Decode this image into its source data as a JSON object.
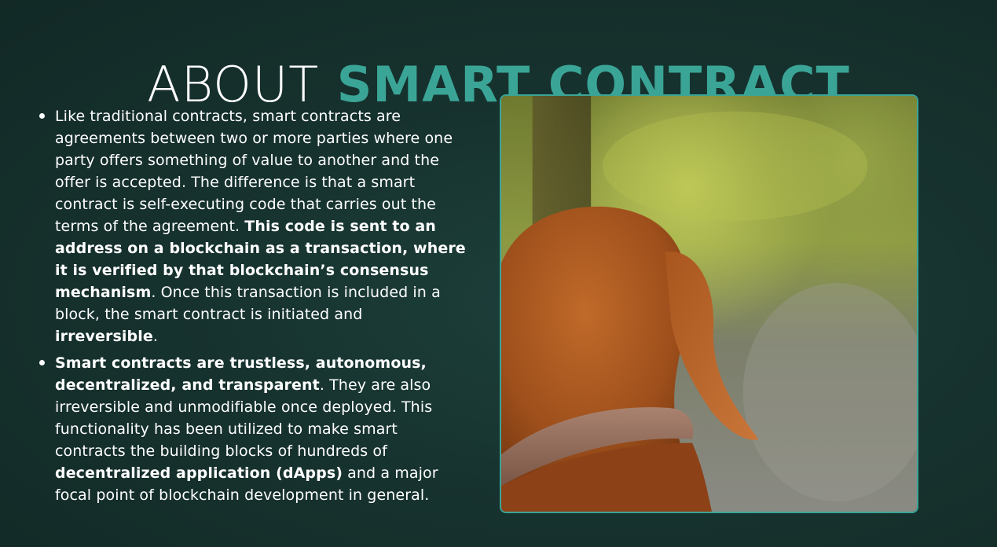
{
  "header": {
    "title_light": "ABOUT",
    "title_accent": "SMART CONTRACT"
  },
  "bullets": [
    {
      "p1": "Like traditional contracts, smart contracts are agreements between two or more parties where one party offers something of value to another and the offer is accepted. The difference is that a smart contract is self-executing code that carries out the terms of the agreement. ",
      "b1": "This code is sent to an address on a blockchain as a transaction, where it is verified by that blockchain’s consensus mechanism",
      "p2": ". Once this transaction is included in a block, the smart contract is initiated and ",
      "b2": "irreversible",
      "p3": "."
    },
    {
      "b1": "Smart contracts are trustless, autonomous, decentralized, and transparent",
      "p1": ". They are also irreversible and unmodifiable once deployed. This functionality has been utilized to make smart contracts the building blocks of hundreds of ",
      "b2": "decentralized application (dApps)",
      "p2": " and a major focal point of blockchain development in general."
    }
  ],
  "image": {
    "subject": "brown-dog-photo"
  },
  "colors": {
    "accent": "#3aa597",
    "background": "#17332f",
    "text": "#ffffff"
  }
}
